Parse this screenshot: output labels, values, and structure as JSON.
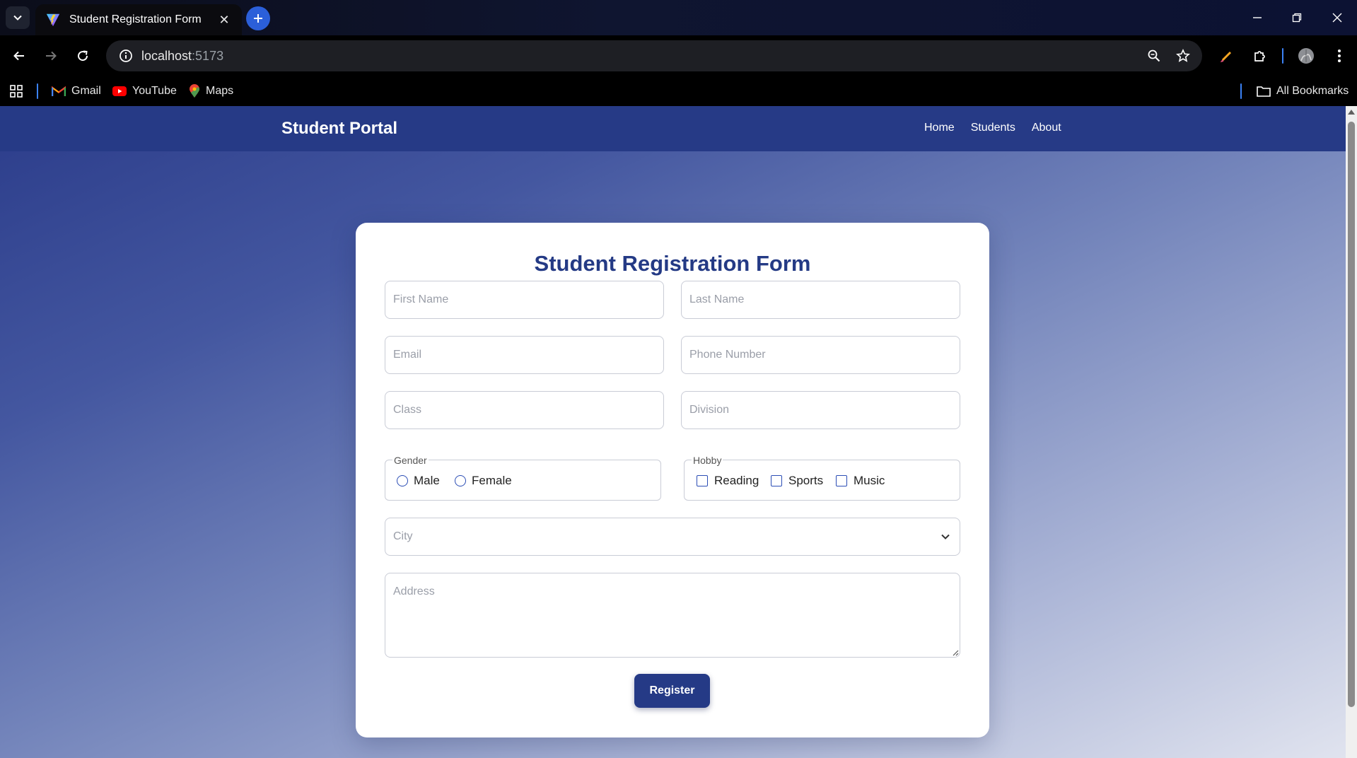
{
  "browser": {
    "tab_title": "Student Registration Form",
    "tab_close_glyph": "✕",
    "new_tab_glyph": "+",
    "url_host": "localhost",
    "url_port": ":5173",
    "bookmarks": [
      {
        "label": "Gmail",
        "icon": "gmail-icon"
      },
      {
        "label": "YouTube",
        "icon": "youtube-icon"
      },
      {
        "label": "Maps",
        "icon": "maps-icon"
      }
    ],
    "all_bookmarks_label": "All Bookmarks",
    "accent_color": "#2b5fd9"
  },
  "app": {
    "brand": "Student Portal",
    "nav": [
      {
        "label": "Home"
      },
      {
        "label": "Students"
      },
      {
        "label": "About"
      }
    ],
    "nav_color": "#263a86"
  },
  "form": {
    "title": "Student Registration Form",
    "first_name_placeholder": "First Name",
    "last_name_placeholder": "Last Name",
    "email_placeholder": "Email",
    "phone_placeholder": "Phone Number",
    "class_placeholder": "Class",
    "division_placeholder": "Division",
    "gender": {
      "legend": "Gender",
      "options": [
        "Male",
        "Female"
      ]
    },
    "hobby": {
      "legend": "Hobby",
      "options": [
        "Reading",
        "Sports",
        "Music"
      ]
    },
    "city_placeholder": "City",
    "address_placeholder": "Address",
    "submit_label": "Register",
    "title_color": "#243a85"
  }
}
